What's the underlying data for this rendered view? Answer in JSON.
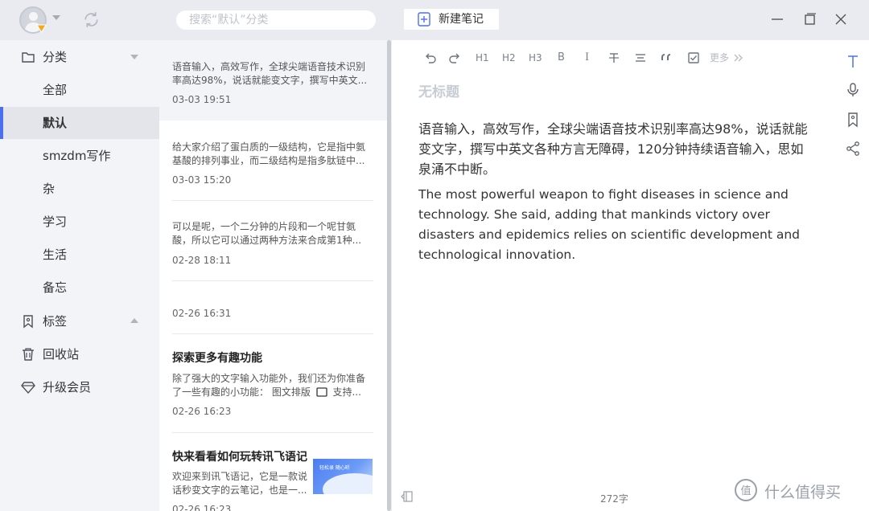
{
  "window": {
    "search_placeholder": "搜索“默认”分类",
    "new_note_label": "新建笔记"
  },
  "sidebar": {
    "items": [
      {
        "label": "分类",
        "icon": "folder-icon"
      },
      {
        "label": "全部"
      },
      {
        "label": "默认"
      },
      {
        "label": "smzdm写作"
      },
      {
        "label": "杂"
      },
      {
        "label": "学习"
      },
      {
        "label": "生活"
      },
      {
        "label": "备忘"
      },
      {
        "label": "标签",
        "icon": "tag-icon"
      },
      {
        "label": "回收站",
        "icon": "trash-icon"
      },
      {
        "label": "升级会员",
        "icon": "diamond-icon"
      }
    ]
  },
  "notes": [
    {
      "title": "",
      "snippet": "语音输入，高效写作，全球尖端语音技术识别率高达98%，说话就能变文字，撰写中英文...",
      "date": "03-03 19:51"
    },
    {
      "title": "",
      "snippet": "给大家介绍了蛋白质的一级结构，它是指中氨基酸的排列事业，而二级结构是指多肽链中...",
      "date": "03-03 15:20"
    },
    {
      "title": "",
      "snippet": "可以是呢，一个二分钟的片段和一个呢甘氨酸，所以它可以通过两种方法来合成第1种...",
      "date": "02-28 18:11"
    },
    {
      "title": "",
      "snippet": "",
      "date": "02-26 16:31"
    },
    {
      "title": "探索更多有趣功能",
      "snippet_line1": "除了强大的文字输入功能外，我们还为你准备",
      "snippet_line2a": "了一些有趣的小功能：   图文排版",
      "snippet_line2b": "支持...",
      "date": "02-26 16:23"
    },
    {
      "title": "快来看看如何玩转讯飞语记",
      "snippet": "欢迎来到讯飞语记，它是一款说话秒变文字的云笔记，也是一...",
      "date": "02-26 16:23",
      "thumb_text": "轻松录 随心听"
    }
  ],
  "editor": {
    "toolbar": {
      "h1": "H1",
      "h2": "H2",
      "h3": "H3",
      "bold": "B",
      "italic": "I",
      "more": "更多"
    },
    "title_placeholder": "无标题",
    "paragraphs": [
      "语音输入，高效写作，全球尖端语音技术识别率高达98%，说话就能变文字，撰写中英文各种方言无障碍，120分钟持续语音输入，思如泉涌不中断。",
      "The most powerful weapon to fight diseases in science and technology. She said, adding that mankinds victory over disasters and epidemics relies on scientific development and technological innovation."
    ],
    "word_count": "272字"
  },
  "watermark": {
    "text": "什么值得买",
    "badge_char": "值"
  },
  "colors": {
    "accent": "#4c6ff0",
    "vip": "#f5a623",
    "topbar": "#e9ebf1",
    "sidebar": "#f3f4f7"
  }
}
